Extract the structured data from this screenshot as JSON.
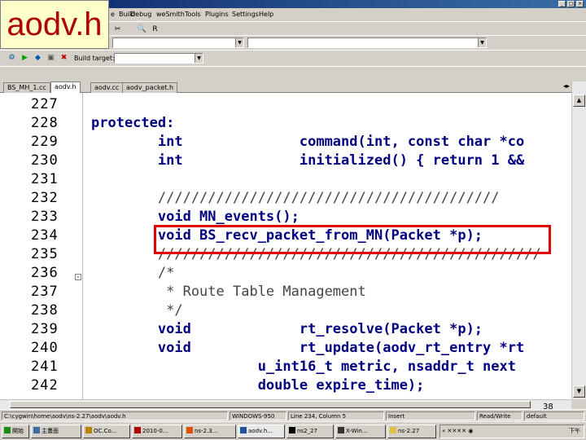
{
  "slide_label": "aodv.h",
  "page_number": "38",
  "menu": [
    "e",
    "Build",
    "Debug",
    "weSmith",
    "Tools",
    "Plugins",
    "Settings",
    "Help"
  ],
  "toolbar": {
    "build_target_label": "Build target:"
  },
  "tabs": [
    {
      "label": "BS_MH_1.cc",
      "active": false
    },
    {
      "label": "aodv.h",
      "active": true
    },
    {
      "label": "aodv.cc",
      "active": false
    },
    {
      "label": "aodv_packet.h",
      "active": false
    }
  ],
  "editor": {
    "lines": [
      {
        "num": "227",
        "code": ""
      },
      {
        "num": "228",
        "code": "protected:"
      },
      {
        "num": "229",
        "code": "        int              command(int, const char *co"
      },
      {
        "num": "230",
        "code": "        int              initialized() { return 1 &&"
      },
      {
        "num": "231",
        "code": ""
      },
      {
        "num": "232",
        "code": "        /////////////////////////////////////////"
      },
      {
        "num": "233",
        "code": "        void MN_events();"
      },
      {
        "num": "234",
        "code": "        void BS_recv_packet_from_MN(Packet *p);"
      },
      {
        "num": "235",
        "code": "        //////////////////////////////////////////////"
      },
      {
        "num": "236",
        "code": "        /*"
      },
      {
        "num": "237",
        "code": "         * Route Table Management"
      },
      {
        "num": "238",
        "code": "         */"
      },
      {
        "num": "239",
        "code": "        void             rt_resolve(Packet *p);"
      },
      {
        "num": "240",
        "code": "        void             rt_update(aodv_rt_entry *rt"
      },
      {
        "num": "241",
        "code": "                    u_int16_t metric, nsaddr_t next"
      },
      {
        "num": "242",
        "code": "                    double expire_time);"
      }
    ]
  },
  "status": {
    "path": "C:\\cygwin\\home\\aodv\\ns-2.27\\aodv\\aodv.h",
    "encoding": "WINDOWS-950",
    "position": "Line 234, Column 5",
    "mode": "Insert",
    "access": "Read/Write",
    "lang": "default"
  },
  "taskbar": [
    {
      "label": "開始"
    },
    {
      "label": "主畫面"
    },
    {
      "label": "OC.Co..."
    },
    {
      "label": "2010-0..."
    },
    {
      "label": "ns-2.3..."
    },
    {
      "label": "aodv.h..."
    },
    {
      "label": "ns2_27"
    },
    {
      "label": "X-Win..."
    },
    {
      "label": "ns-2.27"
    }
  ],
  "tray_time": "下午"
}
